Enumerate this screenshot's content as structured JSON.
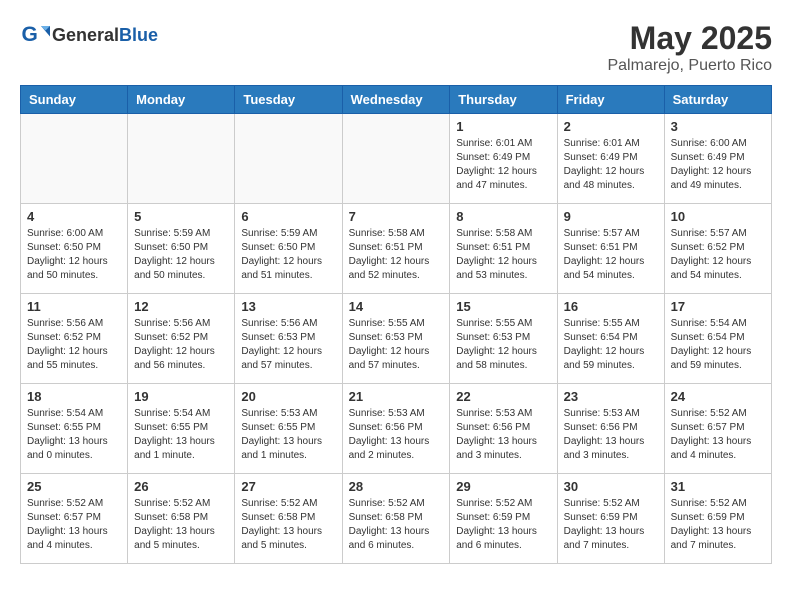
{
  "header": {
    "logo_general": "General",
    "logo_blue": "Blue",
    "month": "May 2025",
    "location": "Palmarejo, Puerto Rico"
  },
  "weekdays": [
    "Sunday",
    "Monday",
    "Tuesday",
    "Wednesday",
    "Thursday",
    "Friday",
    "Saturday"
  ],
  "weeks": [
    [
      {
        "day": "",
        "info": ""
      },
      {
        "day": "",
        "info": ""
      },
      {
        "day": "",
        "info": ""
      },
      {
        "day": "",
        "info": ""
      },
      {
        "day": "1",
        "info": "Sunrise: 6:01 AM\nSunset: 6:49 PM\nDaylight: 12 hours\nand 47 minutes."
      },
      {
        "day": "2",
        "info": "Sunrise: 6:01 AM\nSunset: 6:49 PM\nDaylight: 12 hours\nand 48 minutes."
      },
      {
        "day": "3",
        "info": "Sunrise: 6:00 AM\nSunset: 6:49 PM\nDaylight: 12 hours\nand 49 minutes."
      }
    ],
    [
      {
        "day": "4",
        "info": "Sunrise: 6:00 AM\nSunset: 6:50 PM\nDaylight: 12 hours\nand 50 minutes."
      },
      {
        "day": "5",
        "info": "Sunrise: 5:59 AM\nSunset: 6:50 PM\nDaylight: 12 hours\nand 50 minutes."
      },
      {
        "day": "6",
        "info": "Sunrise: 5:59 AM\nSunset: 6:50 PM\nDaylight: 12 hours\nand 51 minutes."
      },
      {
        "day": "7",
        "info": "Sunrise: 5:58 AM\nSunset: 6:51 PM\nDaylight: 12 hours\nand 52 minutes."
      },
      {
        "day": "8",
        "info": "Sunrise: 5:58 AM\nSunset: 6:51 PM\nDaylight: 12 hours\nand 53 minutes."
      },
      {
        "day": "9",
        "info": "Sunrise: 5:57 AM\nSunset: 6:51 PM\nDaylight: 12 hours\nand 54 minutes."
      },
      {
        "day": "10",
        "info": "Sunrise: 5:57 AM\nSunset: 6:52 PM\nDaylight: 12 hours\nand 54 minutes."
      }
    ],
    [
      {
        "day": "11",
        "info": "Sunrise: 5:56 AM\nSunset: 6:52 PM\nDaylight: 12 hours\nand 55 minutes."
      },
      {
        "day": "12",
        "info": "Sunrise: 5:56 AM\nSunset: 6:52 PM\nDaylight: 12 hours\nand 56 minutes."
      },
      {
        "day": "13",
        "info": "Sunrise: 5:56 AM\nSunset: 6:53 PM\nDaylight: 12 hours\nand 57 minutes."
      },
      {
        "day": "14",
        "info": "Sunrise: 5:55 AM\nSunset: 6:53 PM\nDaylight: 12 hours\nand 57 minutes."
      },
      {
        "day": "15",
        "info": "Sunrise: 5:55 AM\nSunset: 6:53 PM\nDaylight: 12 hours\nand 58 minutes."
      },
      {
        "day": "16",
        "info": "Sunrise: 5:55 AM\nSunset: 6:54 PM\nDaylight: 12 hours\nand 59 minutes."
      },
      {
        "day": "17",
        "info": "Sunrise: 5:54 AM\nSunset: 6:54 PM\nDaylight: 12 hours\nand 59 minutes."
      }
    ],
    [
      {
        "day": "18",
        "info": "Sunrise: 5:54 AM\nSunset: 6:55 PM\nDaylight: 13 hours\nand 0 minutes."
      },
      {
        "day": "19",
        "info": "Sunrise: 5:54 AM\nSunset: 6:55 PM\nDaylight: 13 hours\nand 1 minute."
      },
      {
        "day": "20",
        "info": "Sunrise: 5:53 AM\nSunset: 6:55 PM\nDaylight: 13 hours\nand 1 minutes."
      },
      {
        "day": "21",
        "info": "Sunrise: 5:53 AM\nSunset: 6:56 PM\nDaylight: 13 hours\nand 2 minutes."
      },
      {
        "day": "22",
        "info": "Sunrise: 5:53 AM\nSunset: 6:56 PM\nDaylight: 13 hours\nand 3 minutes."
      },
      {
        "day": "23",
        "info": "Sunrise: 5:53 AM\nSunset: 6:56 PM\nDaylight: 13 hours\nand 3 minutes."
      },
      {
        "day": "24",
        "info": "Sunrise: 5:52 AM\nSunset: 6:57 PM\nDaylight: 13 hours\nand 4 minutes."
      }
    ],
    [
      {
        "day": "25",
        "info": "Sunrise: 5:52 AM\nSunset: 6:57 PM\nDaylight: 13 hours\nand 4 minutes."
      },
      {
        "day": "26",
        "info": "Sunrise: 5:52 AM\nSunset: 6:58 PM\nDaylight: 13 hours\nand 5 minutes."
      },
      {
        "day": "27",
        "info": "Sunrise: 5:52 AM\nSunset: 6:58 PM\nDaylight: 13 hours\nand 5 minutes."
      },
      {
        "day": "28",
        "info": "Sunrise: 5:52 AM\nSunset: 6:58 PM\nDaylight: 13 hours\nand 6 minutes."
      },
      {
        "day": "29",
        "info": "Sunrise: 5:52 AM\nSunset: 6:59 PM\nDaylight: 13 hours\nand 6 minutes."
      },
      {
        "day": "30",
        "info": "Sunrise: 5:52 AM\nSunset: 6:59 PM\nDaylight: 13 hours\nand 7 minutes."
      },
      {
        "day": "31",
        "info": "Sunrise: 5:52 AM\nSunset: 6:59 PM\nDaylight: 13 hours\nand 7 minutes."
      }
    ]
  ]
}
